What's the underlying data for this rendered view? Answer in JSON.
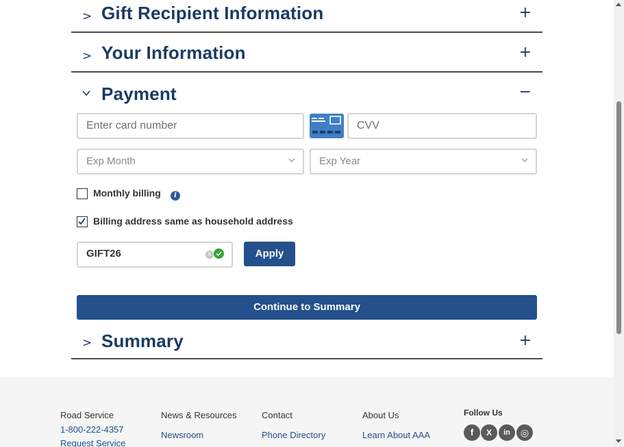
{
  "sections": {
    "gift_recipient": {
      "title": "Gift Recipient Information",
      "chevron": ">",
      "toggle": "+"
    },
    "your_info": {
      "title": "Your Information",
      "chevron": ">",
      "toggle": "+"
    },
    "payment": {
      "title": "Payment",
      "chevron": "v",
      "toggle": "−"
    },
    "summary": {
      "title": "Summary",
      "chevron": ">",
      "toggle": "+"
    }
  },
  "payment_form": {
    "card_number_placeholder": "Enter card number",
    "cvv_placeholder": "CVV",
    "exp_month": "Exp Month",
    "exp_year": "Exp Year",
    "monthly_billing_label": "Monthly billing",
    "monthly_billing_checked": false,
    "billing_same_label": "Billing address same as household address",
    "billing_same_checked": true,
    "promo_code": "GIFT26",
    "apply_label": "Apply",
    "continue_label": "Continue to Summary",
    "info_glyph": "i",
    "clear_glyph": "×"
  },
  "footer": {
    "columns": [
      {
        "heading": "Road Service",
        "links": [
          "1-800-222-4357",
          "Request Service"
        ]
      },
      {
        "heading": "News & Resources",
        "links": [
          "Newsroom"
        ]
      },
      {
        "heading": "Contact",
        "links": [
          "Phone Directory"
        ]
      },
      {
        "heading": "About Us",
        "links": [
          "Learn About AAA"
        ]
      }
    ],
    "follow_heading": "Follow Us",
    "social": [
      {
        "icon": "facebook-icon",
        "glyph": "f"
      },
      {
        "icon": "x-icon",
        "glyph": "X"
      },
      {
        "icon": "linkedin-icon",
        "glyph": "in"
      },
      {
        "icon": "instagram-icon",
        "glyph": "◎"
      }
    ]
  },
  "colors": {
    "primary": "#24508c",
    "heading": "#1b3a64",
    "success": "#36a534",
    "card_icon": "#3f7fc4"
  }
}
